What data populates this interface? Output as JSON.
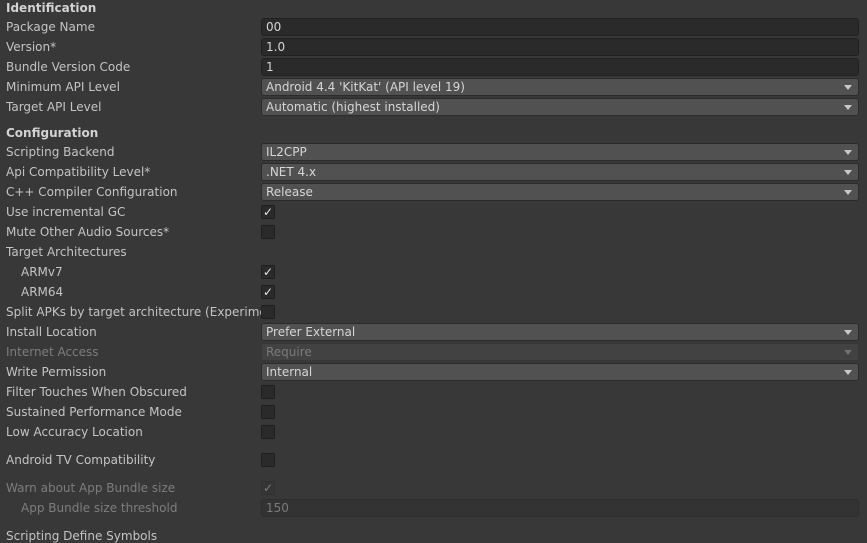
{
  "sections": {
    "identification": "Identification",
    "configuration": "Configuration",
    "scripting_define_symbols": "Scripting Define Symbols"
  },
  "identification": {
    "package_name": {
      "label": "Package Name",
      "value": "00"
    },
    "version": {
      "label": "Version*",
      "value": "1.0"
    },
    "bundle_version_code": {
      "label": "Bundle Version Code",
      "value": "1"
    },
    "minimum_api_level": {
      "label": "Minimum API Level",
      "value": "Android 4.4 'KitKat' (API level 19)"
    },
    "target_api_level": {
      "label": "Target API Level",
      "value": "Automatic (highest installed)"
    }
  },
  "configuration": {
    "scripting_backend": {
      "label": "Scripting Backend",
      "value": "IL2CPP"
    },
    "api_compatibility": {
      "label": "Api Compatibility Level*",
      "value": ".NET 4.x"
    },
    "cpp_compiler": {
      "label": "C++ Compiler Configuration",
      "value": "Release"
    },
    "incremental_gc": {
      "label": "Use incremental GC",
      "checked": true
    },
    "mute_audio": {
      "label": "Mute Other Audio Sources*",
      "checked": false
    },
    "target_architectures": {
      "label": "Target Architectures"
    },
    "armv7": {
      "label": "ARMv7",
      "checked": true
    },
    "arm64": {
      "label": "ARM64",
      "checked": true
    },
    "split_apks": {
      "label": "Split APKs by target architecture (Experimental)",
      "checked": false
    },
    "install_location": {
      "label": "Install Location",
      "value": "Prefer External"
    },
    "internet_access": {
      "label": "Internet Access",
      "value": "Require"
    },
    "write_permission": {
      "label": "Write Permission",
      "value": "Internal"
    },
    "filter_touches": {
      "label": "Filter Touches When Obscured",
      "checked": false
    },
    "sustained_performance": {
      "label": "Sustained Performance Mode",
      "checked": false
    },
    "low_accuracy_location": {
      "label": "Low Accuracy Location",
      "checked": false
    },
    "android_tv": {
      "label": "Android TV Compatibility",
      "checked": false
    },
    "warn_bundle_size": {
      "label": "Warn about App Bundle size",
      "checked": true
    },
    "bundle_size_threshold": {
      "label": "App Bundle size threshold",
      "value": "150"
    }
  },
  "icons": {
    "check": "checkmark-icon",
    "dropdown": "triangle-down-icon"
  },
  "check_glyph": "✓"
}
